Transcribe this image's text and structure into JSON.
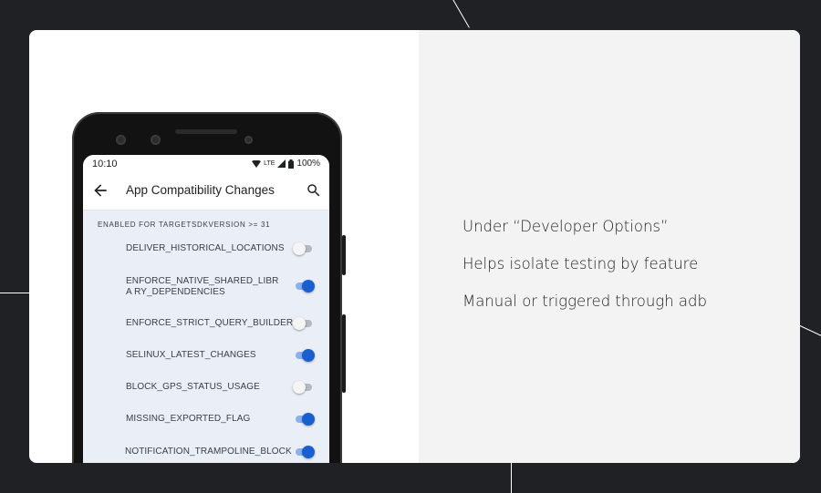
{
  "slide": {
    "bullets": [
      "Under “Developer Options”",
      "Helps isolate testing by feature",
      "Manual or triggered through adb"
    ]
  },
  "phone": {
    "status": {
      "time": "10:10",
      "network": "LTE",
      "battery": "100%",
      "icons": [
        "wifi-icon",
        "signal-icon",
        "battery-icon"
      ]
    },
    "app_bar": {
      "title": "App Compatibility Changes",
      "back_icon": "arrow-left-icon",
      "search_icon": "search-icon"
    },
    "section_header": "ENABLED FOR TARGETSDKVERSION >= 31",
    "changes": [
      {
        "label": "DELIVER_HISTORICAL_LOCATIONS",
        "enabled": false
      },
      {
        "label": "ENFORCE_NATIVE_SHARED_LIBRA RY_DEPENDENCIES",
        "enabled": true
      },
      {
        "label": "ENFORCE_STRICT_QUERY_BUILDER",
        "enabled": false
      },
      {
        "label": "SELINUX_LATEST_CHANGES",
        "enabled": true
      },
      {
        "label": "BLOCK_GPS_STATUS_USAGE",
        "enabled": false
      },
      {
        "label": "MISSING_EXPORTED_FLAG",
        "enabled": true
      },
      {
        "label": "NOTIFICATION_TRAMPOLINE_BLOCK",
        "enabled": true
      }
    ]
  },
  "colors": {
    "background": "#202124",
    "slide": "#ffffff",
    "panel": "#f3f3f3",
    "toggle_on": "#1a5fd0",
    "screen": "#e9eef7"
  }
}
